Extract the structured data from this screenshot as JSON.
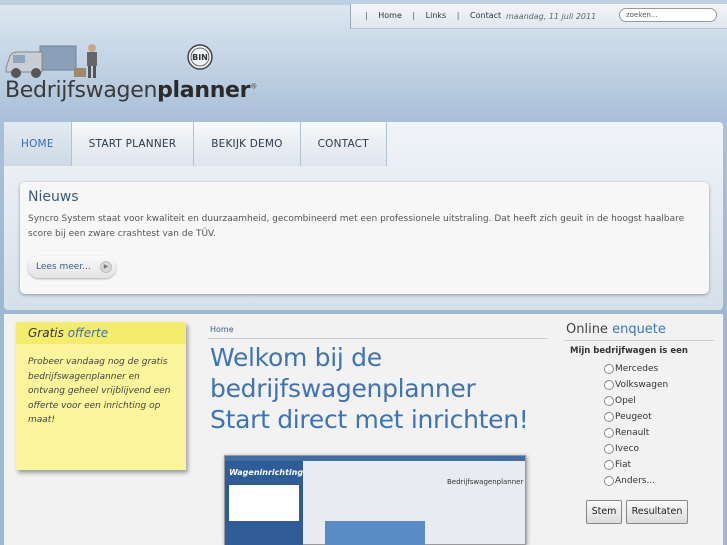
{
  "topbar": {
    "links": [
      "Home",
      "Links",
      "Contact"
    ],
    "date": "maandag, 11 juli 2011",
    "search_placeholder": "zoeken..."
  },
  "logo": {
    "name_regular": "Bedrijfswagen",
    "name_bold": "planner",
    "registered": "®",
    "badge_text": "BIN"
  },
  "nav": {
    "items": [
      "HOME",
      "START PLANNER",
      "BEKIJK DEMO",
      "CONTACT"
    ],
    "active_index": 0
  },
  "news": {
    "title": "Nieuws",
    "text": "Syncro System staat voor kwaliteit en duurzaamheid, gecombineerd met een professionele uitstraling. Dat heeft zich geuit in de hoogst haalbare score bij een zware crashtest van de TÜV.",
    "more_label": "Lees meer..."
  },
  "offerte": {
    "title_plain": "Gratis",
    "title_accent": "offerte",
    "text": "Probeer vandaag nog de gratis bedrijfswagenplanner en ontvang geheel vrijblijvend een offerte voor een inrichting op maat!"
  },
  "main": {
    "breadcrumb": "Home",
    "headline_lines": [
      "Welkom bij de",
      "bedrijfswagenplanner",
      "Start direct met inrichten!"
    ],
    "screenshot": {
      "side_title": "Wageninrichting",
      "logo_text": "Bedrijfswagenplanner"
    }
  },
  "poll": {
    "title_plain": "Online",
    "title_accent": "enquete",
    "question": "Mijn bedrijfwagen is een",
    "options": [
      "Mercedes",
      "Volkswagen",
      "Opel",
      "Peugeot",
      "Renault",
      "Iveco",
      "Fiat",
      "Anders..."
    ],
    "vote_label": "Stem",
    "results_label": "Resultaten"
  },
  "colors": {
    "accent": "#3e74b3",
    "nav_active": "#3b6db0",
    "sticky": "#fbf59b"
  }
}
